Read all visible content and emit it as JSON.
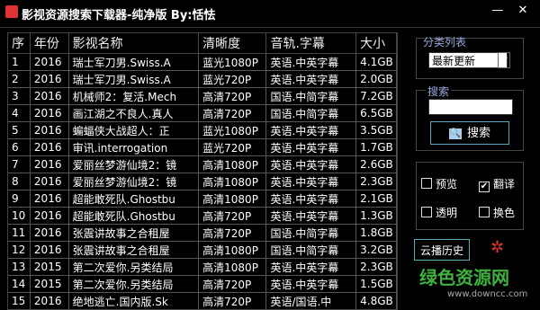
{
  "window": {
    "title": "影视资源搜索下载器-纯净版 By:恬怯",
    "minimize": "—",
    "close": "✕"
  },
  "table": {
    "headers": [
      "序",
      "年份",
      "影视名称",
      "清晰度",
      "音轨.字幕",
      "大小"
    ],
    "rows": [
      [
        "1",
        "2016",
        "瑞士军刀男.Swiss.A",
        "蓝光1080P",
        "英语.中英字幕",
        "4.1GB"
      ],
      [
        "2",
        "2016",
        "瑞士军刀男.Swiss.A",
        "蓝光720P",
        "英语.中英字幕",
        "2.0GB"
      ],
      [
        "3",
        "2016",
        "机械师2：复活.Mech",
        "高清720P",
        "国语.中简字幕",
        "7.2GB"
      ],
      [
        "4",
        "2016",
        "画江湖之不良人.真人",
        "高清720P",
        "国语.中简字幕",
        "6.5GB"
      ],
      [
        "5",
        "2016",
        "蝙蝠侠大战超人：正",
        "蓝光1080P",
        "英语.中英字幕",
        "3.5GB"
      ],
      [
        "6",
        "2016",
        "审讯.interrogation",
        "蓝光720P",
        "英语.中英字幕",
        "1.7GB"
      ],
      [
        "7",
        "2016",
        "爱丽丝梦游仙境2：镜",
        "高清1080P",
        "英语.中英字幕",
        "2.6GB"
      ],
      [
        "8",
        "2016",
        "爱丽丝梦游仙境2：镜",
        "高清1080P",
        "英语.中英字幕",
        "2.3GB"
      ],
      [
        "9",
        "2016",
        "超能敢死队.Ghostbu",
        "高清1080P",
        "英语.中英字幕",
        "2.1GB"
      ],
      [
        "10",
        "2016",
        "超能敢死队.Ghostbu",
        "高清720P",
        "英语.中英字幕",
        "1.3GB"
      ],
      [
        "11",
        "2016",
        "张震讲故事之合租屋",
        "高清720P",
        "国语.中简字幕",
        "1.8GB"
      ],
      [
        "12",
        "2016",
        "张震讲故事之合租屋",
        "高清1080P",
        "国语.中简字幕",
        "3.2GB"
      ],
      [
        "13",
        "2015",
        "第二次爱你.另类结局",
        "高清1080P",
        "英语.中英字幕",
        "2.3GB"
      ],
      [
        "14",
        "2015",
        "第二次爱你.另类结局",
        "高清720P",
        "英语.中英字幕",
        "1.5GB"
      ],
      [
        "15",
        "2016",
        "绝地逃亡.国内版.Sk",
        "高清720P",
        "英语/国语.中",
        "4.8GB"
      ]
    ]
  },
  "sidebar": {
    "sort_label": "分类列表",
    "sort_value": "最新更新",
    "sort_arrow": "▼",
    "search_label": "搜索",
    "search_value": "",
    "search_button": "搜索",
    "search_button_icon": "🔍",
    "preview_label": "预览",
    "translate_label": "翻译",
    "transparent_label": "透明",
    "color_label": "换色",
    "check_mark": "✔",
    "history_button": "云播历史",
    "gear": "✲"
  },
  "watermark": {
    "main": "绿色资源网",
    "url": "www.downcc.com"
  }
}
